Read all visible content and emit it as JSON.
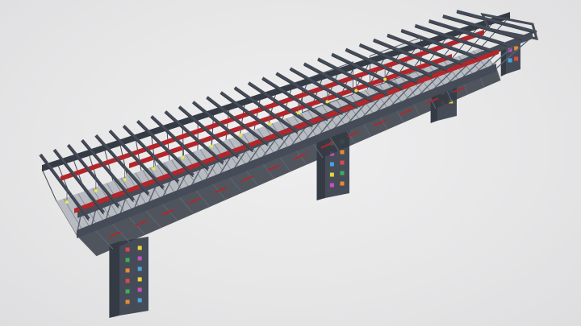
{
  "viewer": {
    "background": "#e8e8e9"
  },
  "model": {
    "subject": "steel-overpass-structure",
    "colors": {
      "steel": "#454c57",
      "steel_dark": "#353b44",
      "steel_light": "#5b6370",
      "beam_red": "#b3262b",
      "grating": "#b8bcc2",
      "panel_white": "#dcdde0",
      "lamp_yellow": "#e9e84a"
    },
    "column_light_colors": [
      "#e04848",
      "#e8d43c",
      "#3fae5a",
      "#c64fc4",
      "#e88a32",
      "#49a4df"
    ],
    "cross_beam_count": 31,
    "column_count": 4
  }
}
